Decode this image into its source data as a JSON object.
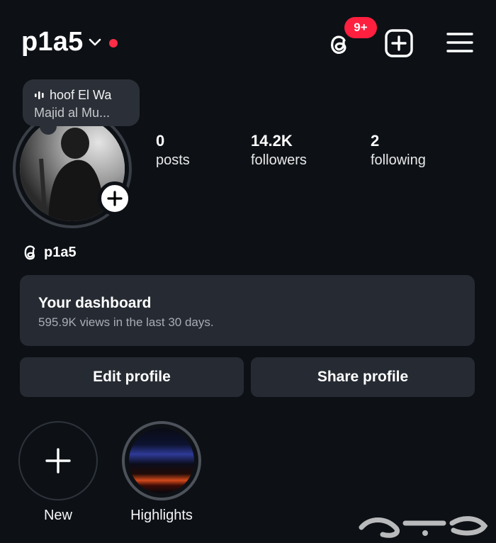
{
  "header": {
    "username": "p1a5",
    "badge": "9+"
  },
  "music": {
    "title": "hoof El Wa",
    "artist": "Majid al Mu..."
  },
  "stats": [
    {
      "value": "0",
      "label": "posts"
    },
    {
      "value": "14.2K",
      "label": "followers"
    },
    {
      "value": "2",
      "label": "following"
    }
  ],
  "threads_handle": "p1a5",
  "dashboard": {
    "title": "Your dashboard",
    "subtitle": "595.9K views in the last 30 days."
  },
  "buttons": {
    "edit": "Edit profile",
    "share": "Share profile"
  },
  "highlights": [
    {
      "label": "New"
    },
    {
      "label": "Highlights"
    }
  ],
  "icons": [
    "chevron-down-icon",
    "threads-icon",
    "add-post-icon",
    "menu-icon",
    "sound-bars-icon",
    "plus-icon"
  ],
  "colors": {
    "background": "#0d1116",
    "surface": "#262b33",
    "badge": "#ff1f3f"
  }
}
